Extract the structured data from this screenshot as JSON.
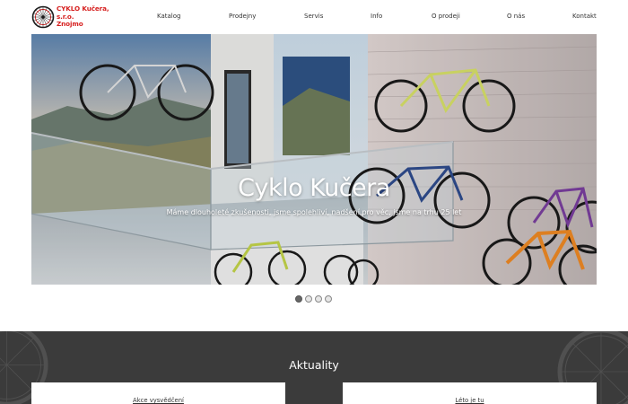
{
  "brand": {
    "line1": "CYKLO Kučera, s.r.o.",
    "line2": "Znojmo",
    "color": "#d6201f"
  },
  "nav": {
    "items": [
      {
        "label": "Katalog"
      },
      {
        "label": "Prodejny"
      },
      {
        "label": "Servis"
      },
      {
        "label": "Info"
      },
      {
        "label": "O prodeji"
      },
      {
        "label": "O nás"
      },
      {
        "label": "Kontakt"
      }
    ]
  },
  "hero": {
    "title": "Cyklo Kučera",
    "subtitle": "Máme dlouholeté zkušenosti, jsme spolehliví, nadšení pro věc, jsme na trhu 25 let"
  },
  "slider": {
    "count": 4,
    "active_index": 0
  },
  "news": {
    "heading": "Aktuality",
    "cards": [
      {
        "title": "Akce vysvědčení"
      },
      {
        "title": "Léto je tu"
      }
    ]
  },
  "colors": {
    "news_bg": "#3b3b3b",
    "nav_text": "#333333"
  }
}
